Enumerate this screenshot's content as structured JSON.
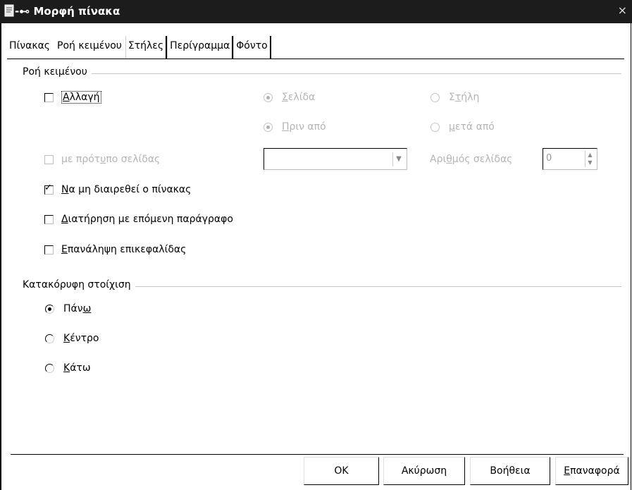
{
  "window": {
    "title": "Μορφή πίνακα",
    "close_glyph": "×"
  },
  "tabs": [
    {
      "label": "Πίνακας"
    },
    {
      "label": "Ροή κειμένου",
      "active": true
    },
    {
      "label": "Στήλες"
    },
    {
      "label": "Περίγραμμα"
    },
    {
      "label": "Φόντο"
    }
  ],
  "text_flow": {
    "group_label": "Ροή κειμένου",
    "break": {
      "label_u": "Α",
      "label_rest": "λλαγή",
      "checked": false
    },
    "page": {
      "label_u": "Σ",
      "label_rest": "ελίδα",
      "selected": true,
      "enabled": false
    },
    "column": {
      "label_pre": "Σ",
      "label_u": "τ",
      "label_rest": "ήλη",
      "selected": false,
      "enabled": false
    },
    "before": {
      "label_u": "Π",
      "label_rest": "ριν από",
      "selected": true,
      "enabled": false
    },
    "after": {
      "label_u": "μ",
      "label_rest": "ετά από",
      "selected": false,
      "enabled": false
    },
    "with_page_style": {
      "label_pre": "με πρότ",
      "label_u": "υ",
      "label_rest": "πο σελίδας",
      "checked": false,
      "enabled": false
    },
    "page_style_value": "",
    "page_number": {
      "label_pre": "Αρι",
      "label_u": "θ",
      "label_rest": "μός σελίδας",
      "value": "0"
    },
    "no_split": {
      "label_u": "Ν",
      "label_rest": "α μη διαιρεθεί ο πίνακας",
      "checked": true
    },
    "keep_with_next": {
      "label_u": "Δ",
      "label_rest": "ιατήρηση με επόμενη παράγραφο",
      "checked": false
    },
    "repeat_heading": {
      "label_u": "Ε",
      "label_rest": "πανάληψη επικεφαλίδας",
      "checked": false
    }
  },
  "vertical_alignment": {
    "group_label": "Κατακόρυφη στοίχιση",
    "top": {
      "label_pre": "Πάν",
      "label_u": "ω",
      "label_rest": "",
      "selected": true
    },
    "center": {
      "label_u": "Κ",
      "label_rest": "έντρο",
      "selected": false
    },
    "bottom": {
      "label_u": "Κ",
      "label_rest": "άτω",
      "selected": false
    }
  },
  "buttons": {
    "ok": "OK",
    "cancel": "Ακύρωση",
    "help": "Βοήθεια",
    "reset_u": "Ε",
    "reset_rest": "παναφορά"
  }
}
